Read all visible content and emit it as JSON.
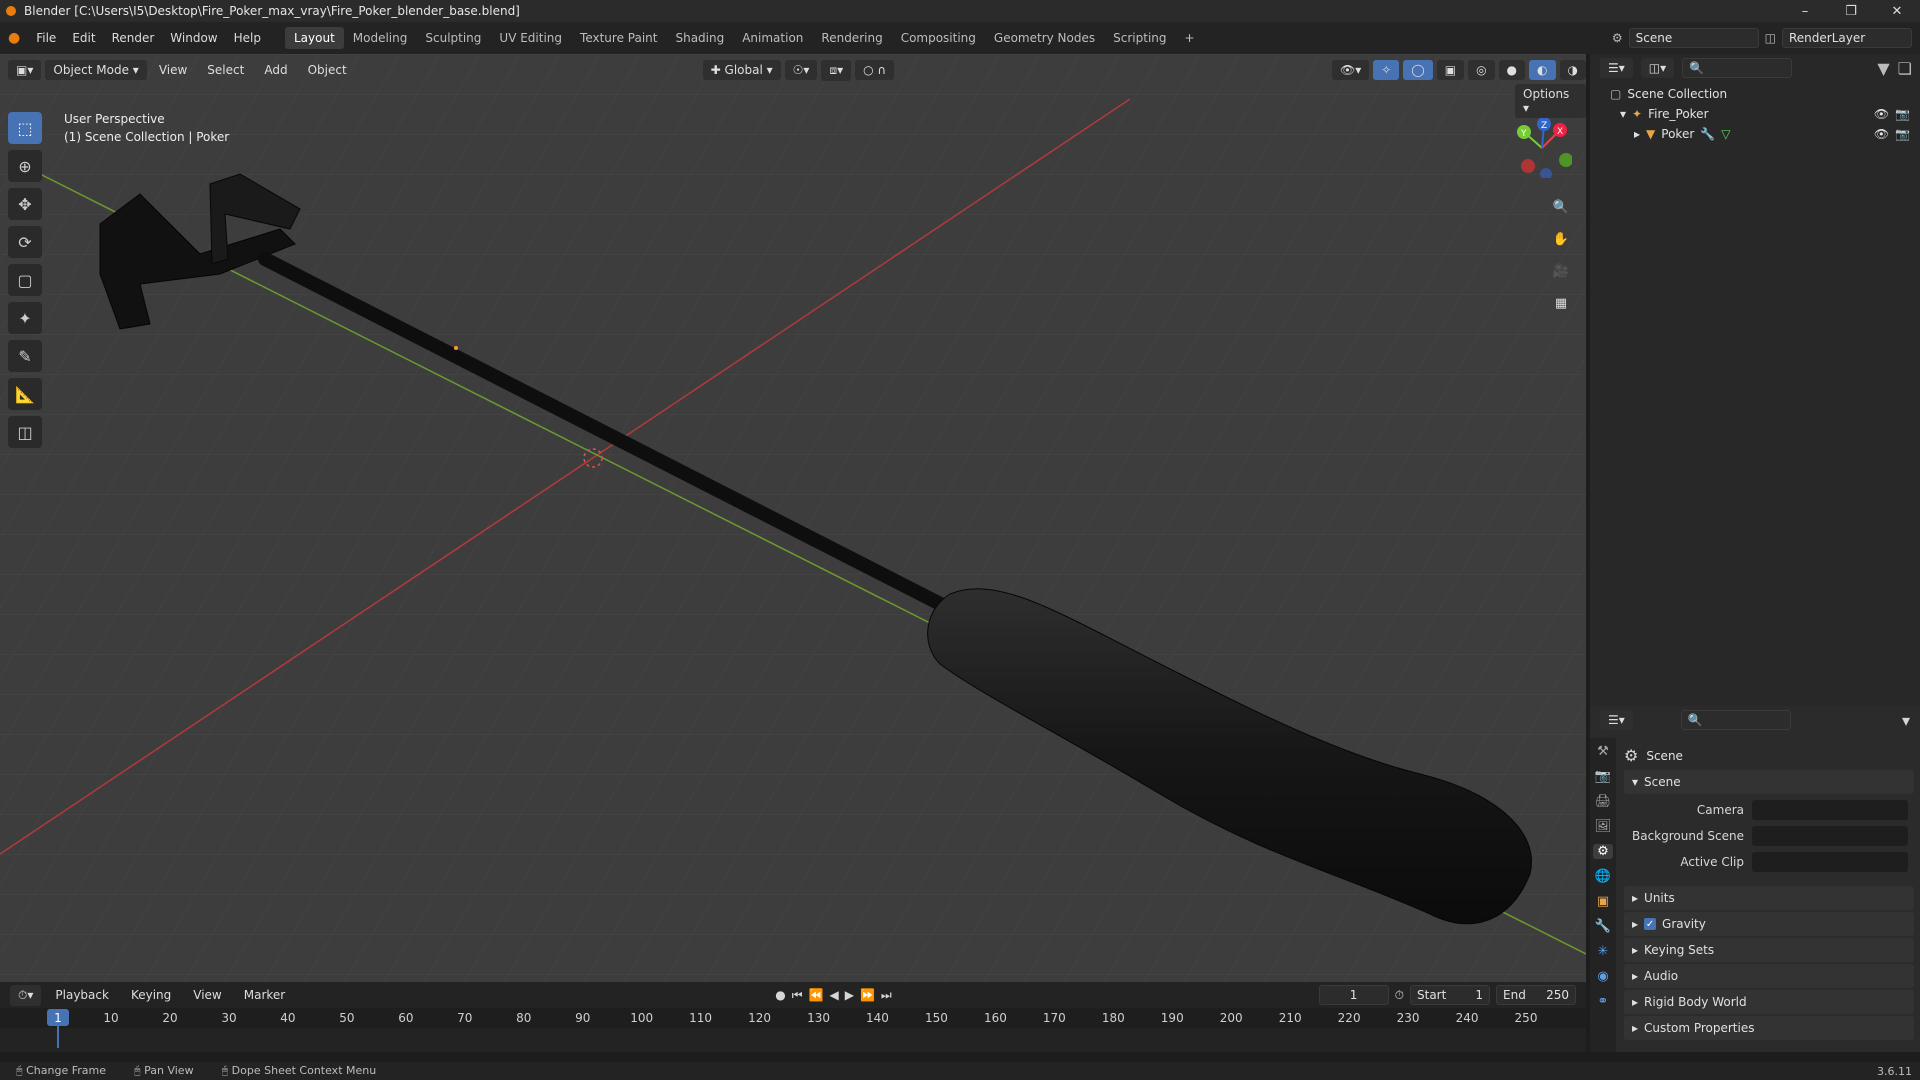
{
  "window": {
    "title": "Blender [C:\\Users\\I5\\Desktop\\Fire_Poker_max_vray\\Fire_Poker_blender_base.blend]",
    "controls": [
      "–",
      "❐",
      "✕"
    ]
  },
  "menu": {
    "items": [
      "File",
      "Edit",
      "Render",
      "Window",
      "Help"
    ]
  },
  "workspaces": {
    "tabs": [
      "Layout",
      "Modeling",
      "Sculpting",
      "UV Editing",
      "Texture Paint",
      "Shading",
      "Animation",
      "Rendering",
      "Compositing",
      "Geometry Nodes",
      "Scripting",
      "+"
    ],
    "active": "Layout"
  },
  "scene_selector": {
    "label": "Scene",
    "render_layer": "RenderLayer"
  },
  "viewport": {
    "mode": "Object Mode",
    "header_menus": [
      "View",
      "Select",
      "Add",
      "Object"
    ],
    "transform_orientation": "Global",
    "options_label": "Options",
    "info_line1": "User Perspective",
    "info_line2": "(1) Scene Collection | Poker",
    "gizmo_axes": [
      "X",
      "Y",
      "Z"
    ]
  },
  "outliner": {
    "root": "Scene Collection",
    "items": [
      {
        "label": "Fire_Poker",
        "indent": 1
      },
      {
        "label": "Poker",
        "indent": 2
      }
    ]
  },
  "properties": {
    "context": "Scene",
    "panel_title": "Scene",
    "fields": [
      {
        "label": "Camera",
        "value": ""
      },
      {
        "label": "Background Scene",
        "value": ""
      },
      {
        "label": "Active Clip",
        "value": ""
      }
    ],
    "subpanels": [
      "Units",
      "Gravity",
      "Keying Sets",
      "Audio",
      "Rigid Body World",
      "Custom Properties"
    ],
    "gravity_checked": true
  },
  "timeline": {
    "menus": [
      "Playback",
      "Keying",
      "View",
      "Marker"
    ],
    "current_frame": "1",
    "start_label": "Start",
    "start": "1",
    "end_label": "End",
    "end": "250",
    "ruler_ticks": [
      "1",
      "10",
      "20",
      "30",
      "40",
      "50",
      "60",
      "70",
      "80",
      "90",
      "100",
      "110",
      "120",
      "130",
      "140",
      "150",
      "160",
      "170",
      "180",
      "190",
      "200",
      "210",
      "220",
      "230",
      "240",
      "250"
    ]
  },
  "statusbar": {
    "items": [
      "Change Frame",
      "Pan View",
      "Dope Sheet Context Menu"
    ],
    "version": "3.6.11"
  }
}
